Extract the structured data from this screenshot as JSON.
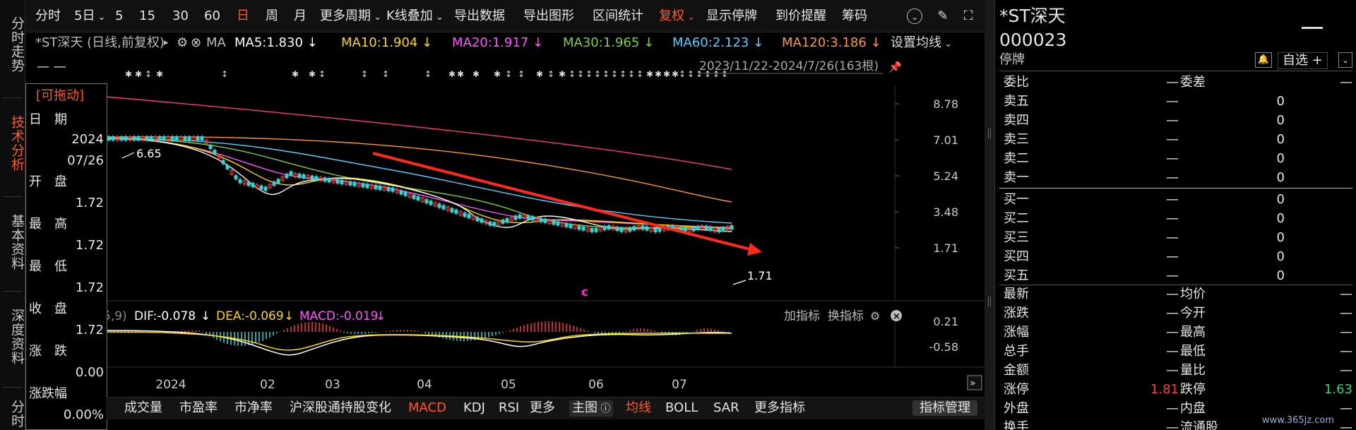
{
  "left_tabs": [
    {
      "label": "分时走势",
      "active": false
    },
    {
      "label": "技术分析",
      "active": true
    },
    {
      "label": "基本资料",
      "active": false
    },
    {
      "label": "深度资料",
      "active": false
    },
    {
      "label": "分时",
      "active": false
    }
  ],
  "toolbar": {
    "items": [
      {
        "label": "分时",
        "active": false
      },
      {
        "label": "5日",
        "active": false,
        "dropdown": true
      },
      {
        "label": "5",
        "active": false
      },
      {
        "label": "15",
        "active": false
      },
      {
        "label": "30",
        "active": false
      },
      {
        "label": "60",
        "active": false
      },
      {
        "label": "日",
        "active": true
      },
      {
        "label": "周",
        "active": false
      },
      {
        "label": "月",
        "active": false
      },
      {
        "label": "更多周期",
        "active": false,
        "dropdown": true
      },
      {
        "label": "K线叠加",
        "active": false,
        "dropdown": true
      },
      {
        "label": "导出数据",
        "active": false
      },
      {
        "label": "导出图形",
        "active": false
      },
      {
        "label": "区间统计",
        "active": false
      },
      {
        "label": "复权",
        "active": true,
        "dropdown": true
      },
      {
        "label": "显示停牌",
        "active": false
      },
      {
        "label": "到价提醒",
        "active": false
      },
      {
        "label": "筹码",
        "active": false
      }
    ],
    "icons": [
      "chevron-down-circle-icon",
      "brush-icon",
      "fullscreen-icon"
    ]
  },
  "legend": {
    "stock_title": "*ST深天 (日线,前复权)",
    "ma_label": "MA",
    "ma": [
      {
        "text": "MA5:1.830",
        "arrow": "↓",
        "color": "#ffffff"
      },
      {
        "text": "MA10:1.904",
        "arrow": "↓",
        "color": "#ffd700"
      },
      {
        "text": "MA20:1.917",
        "arrow": "↓",
        "color": "#ff55ff"
      },
      {
        "text": "MA30:1.965",
        "arrow": "↓",
        "color": "#7fd13b"
      },
      {
        "text": "MA60:2.123",
        "arrow": "↓",
        "color": "#55d0ff"
      },
      {
        "text": "MA120:3.186",
        "arrow": "↓",
        "color": "#ff9a2e"
      }
    ],
    "settings": "设置均线",
    "dash": "— —",
    "range": "2023/11/22-2024/7/26(163根)"
  },
  "popup": {
    "title": "[可拖动]",
    "rows": [
      {
        "label": "日　期",
        "value": "2024"
      },
      {
        "label": "",
        "value": "07/26"
      },
      {
        "label": "开　盘",
        "value": "1.72"
      },
      {
        "label": "最　高",
        "value": "1.72"
      },
      {
        "label": "最　低",
        "value": "1.72"
      },
      {
        "label": "收　盘",
        "value": "1.72"
      },
      {
        "label": "涨　跌",
        "value": "0.00"
      },
      {
        "label": "涨跌幅",
        "value": "0.00%"
      }
    ]
  },
  "chart_data": {
    "type": "candlestick",
    "price_axis": [
      "8.78",
      "7.01",
      "5.24",
      "3.48",
      "1.71"
    ],
    "high_label": "6.65",
    "low_label": "1.71",
    "macd_axis": [
      "0.21",
      "-0.58"
    ],
    "macd_legend": {
      "prefix": "5,9)",
      "dif": "DIF:-0.078",
      "dea": "DEA:-0.069",
      "macd": "MACD:-0.019"
    },
    "macd_actions": {
      "add": "加指标",
      "switch": "换指标"
    },
    "x_labels": [
      "2024",
      "02",
      "03",
      "04",
      "05",
      "06",
      "07"
    ],
    "marker": "c"
  },
  "bottom_bar": {
    "items": [
      "成交量",
      "市盈率",
      "市净率",
      "沪深股通持股变化",
      "MACD",
      "KDJ",
      "RSI",
      "更多",
      "主图",
      "均线",
      "BOLL",
      "SAR",
      "更多指标"
    ],
    "active": [
      "MACD",
      "均线"
    ],
    "manage": "指标管理"
  },
  "right_panel": {
    "name": "*ST深天",
    "code": "000023",
    "status": "停牌",
    "add_watch": "自选 +",
    "top_rows": [
      {
        "l": "委比",
        "v": "—",
        "l2": "委差",
        "v2": "—"
      }
    ],
    "orders": [
      {
        "l": "卖五",
        "p": "—",
        "v": "0"
      },
      {
        "l": "卖四",
        "p": "—",
        "v": "0"
      },
      {
        "l": "卖三",
        "p": "—",
        "v": "0"
      },
      {
        "l": "卖二",
        "p": "—",
        "v": "0"
      },
      {
        "l": "卖一",
        "p": "—",
        "v": "0"
      },
      {
        "l": "买一",
        "p": "—",
        "v": "0"
      },
      {
        "l": "买二",
        "p": "—",
        "v": "0"
      },
      {
        "l": "买三",
        "p": "—",
        "v": "0"
      },
      {
        "l": "买四",
        "p": "—",
        "v": "0"
      },
      {
        "l": "买五",
        "p": "—",
        "v": "0"
      }
    ],
    "stats": [
      {
        "l": "最新",
        "v": "—",
        "l2": "均价",
        "v2": "—"
      },
      {
        "l": "涨跌",
        "v": "—",
        "l2": "今开",
        "v2": "—"
      },
      {
        "l": "涨幅",
        "v": "—",
        "l2": "最高",
        "v2": "—"
      },
      {
        "l": "总手",
        "v": "—",
        "l2": "最低",
        "v2": "—"
      },
      {
        "l": "金额",
        "v": "—",
        "l2": "量比",
        "v2": "—"
      },
      {
        "l": "涨停",
        "v": "1.81",
        "l2": "跌停",
        "v2": "1.63"
      },
      {
        "l": "外盘",
        "v": "—",
        "l2": "内盘",
        "v2": "—"
      },
      {
        "l": "换手",
        "v": "—",
        "l2": "流通股",
        "v2": "—"
      }
    ],
    "limit_up_color": "#ff3b3b",
    "limit_down_color": "#3bd16f"
  },
  "watermark": "www.365jz.com"
}
